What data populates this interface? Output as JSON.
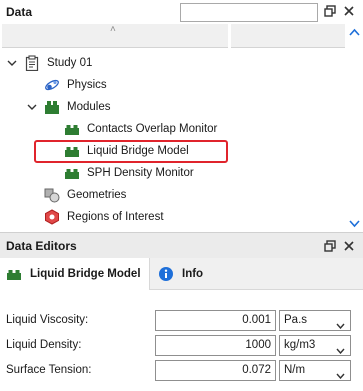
{
  "data_panel": {
    "title": "Data",
    "search": {
      "value": "",
      "placeholder": ""
    }
  },
  "tree": {
    "items": [
      {
        "label": "Study 01",
        "icon": "clipboard-icon",
        "expanded": true
      },
      {
        "label": "Physics",
        "icon": "physics-icon"
      },
      {
        "label": "Modules",
        "icon": "modules-icon",
        "expanded": true
      },
      {
        "label": "Contacts Overlap Monitor",
        "icon": "module-icon"
      },
      {
        "label": "Liquid Bridge Model",
        "icon": "module-icon",
        "selected": true
      },
      {
        "label": "SPH Density Monitor",
        "icon": "module-icon"
      },
      {
        "label": "Geometries",
        "icon": "geometries-icon"
      },
      {
        "label": "Regions of Interest",
        "icon": "regions-icon"
      }
    ]
  },
  "editors_panel": {
    "title": "Data Editors",
    "tabs": [
      {
        "label": "Liquid Bridge Model",
        "icon": "module-icon",
        "active": true
      },
      {
        "label": "Info",
        "icon": "info-icon",
        "active": false
      }
    ],
    "fields": [
      {
        "label": "Liquid Viscosity:",
        "value": "0.001",
        "unit": "Pa.s"
      },
      {
        "label": "Liquid Density:",
        "value": "1000",
        "unit": "kg/m3"
      },
      {
        "label": "Surface Tension:",
        "value": "0.072",
        "unit": "N/m"
      }
    ]
  },
  "colors": {
    "module_green": "#2e7d32",
    "selection_outline": "#e0242c",
    "info_blue": "#1e6fd9"
  }
}
